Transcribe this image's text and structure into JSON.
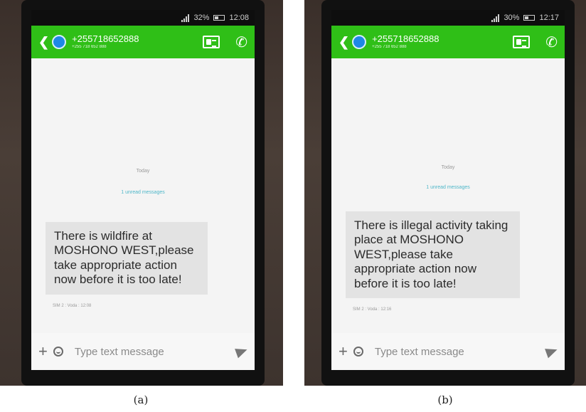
{
  "panels": [
    {
      "caption": "(a)",
      "status": {
        "battery": "32%",
        "time": "12:08"
      },
      "contact": {
        "name": "+255718652888",
        "sub": "+255 718 652 888"
      },
      "conversation": {
        "date_label": "Today",
        "unread_label": "1 unread messages",
        "message": "There is wildfire at MOSHONO WEST,please take appropriate action now before it is too late!",
        "meta": "SIM 2 : Voda : 12:08"
      },
      "composer": {
        "placeholder": "Type text message"
      }
    },
    {
      "caption": "(b)",
      "status": {
        "battery": "30%",
        "time": "12:17"
      },
      "contact": {
        "name": "+255718652888",
        "sub": "+255 718 652 888"
      },
      "conversation": {
        "date_label": "Today",
        "unread_label": "1 unread messages",
        "message": "There is illegal activity taking place at MOSHONO WEST,please take appropriate action now before it is too late!",
        "meta": "SIM 2 : Voda : 12:16"
      },
      "composer": {
        "placeholder": "Type text message"
      }
    }
  ],
  "colors": {
    "app_bar": "#2fbf17",
    "avatar": "#1e88e5",
    "unread": "#4fb7c9",
    "bubble": "#e3e3e3"
  },
  "icons": [
    "back-icon",
    "avatar",
    "contact-card-icon",
    "phone-call-icon",
    "plus-icon",
    "emoji-icon",
    "send-icon",
    "signal-icon",
    "battery-icon"
  ]
}
